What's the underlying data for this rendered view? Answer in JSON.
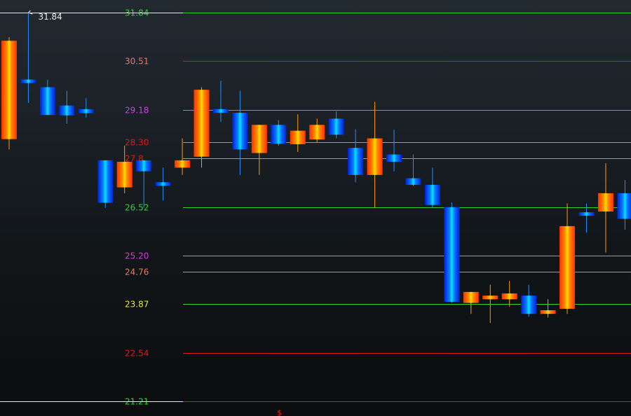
{
  "chart_data": {
    "type": "candlestick",
    "ylim": [
      21.21,
      31.84
    ],
    "high_marker": "31.84",
    "bottom_marker": "$",
    "colors": {
      "up": "#ff8a00",
      "down": "#0a86ff",
      "green": "#2fd22f",
      "red": "#e01818",
      "gray": "#9a9a9a",
      "magenta": "#d23fd2",
      "salmon": "#e07a6a",
      "yellow": "#e6e23a",
      "white": "#e8e8e8"
    },
    "levels": [
      {
        "label": "31.84",
        "value": 31.84,
        "kind": "green",
        "text": "green"
      },
      {
        "label": "30.51",
        "value": 30.51,
        "kind": "red",
        "text": "salmon"
      },
      {
        "label": "29.18",
        "value": 29.18,
        "kind": "green",
        "text": "magenta"
      },
      {
        "label": "28.30",
        "value": 28.3,
        "kind": "gray",
        "text": "red"
      },
      {
        "label": "27.8",
        "value": 27.86,
        "kind": "gray",
        "text": "red"
      },
      {
        "label": "26.52",
        "value": 26.52,
        "kind": "green",
        "text": "green"
      },
      {
        "label": "25.20",
        "value": 25.2,
        "kind": "gray",
        "text": "magenta"
      },
      {
        "label": "24.76",
        "value": 24.76,
        "kind": "gray",
        "text": "salmon"
      },
      {
        "label": "23.87",
        "value": 23.87,
        "kind": "green",
        "text": "yellow"
      },
      {
        "label": "22.54",
        "value": 22.54,
        "kind": "red",
        "text": "red"
      },
      {
        "label": "21.21",
        "value": 21.21,
        "kind": "red",
        "text": "green"
      }
    ],
    "candles": [
      {
        "open": 28.38,
        "high": 31.17,
        "low": 28.1,
        "close": 31.07,
        "dir": "up"
      },
      {
        "open": 30.01,
        "high": 31.84,
        "low": 29.37,
        "close": 29.97,
        "dir": "down"
      },
      {
        "open": 29.8,
        "high": 30.0,
        "low": 29.44,
        "close": 29.04,
        "dir": "down"
      },
      {
        "open": 29.3,
        "high": 29.7,
        "low": 28.8,
        "close": 29.03,
        "dir": "down"
      },
      {
        "open": 29.2,
        "high": 29.5,
        "low": 28.97,
        "close": 29.09,
        "dir": "down"
      },
      {
        "open": 27.8,
        "high": 27.8,
        "low": 26.5,
        "close": 26.64,
        "dir": "down"
      },
      {
        "open": 27.06,
        "high": 28.2,
        "low": 26.9,
        "close": 27.76,
        "dir": "up"
      },
      {
        "open": 27.8,
        "high": 27.8,
        "low": 26.5,
        "close": 27.5,
        "dir": "down"
      },
      {
        "open": 27.2,
        "high": 27.6,
        "low": 26.7,
        "close": 27.13,
        "dir": "down"
      },
      {
        "open": 27.6,
        "high": 28.4,
        "low": 27.4,
        "close": 27.8,
        "dir": "up"
      },
      {
        "open": 27.9,
        "high": 29.8,
        "low": 27.6,
        "close": 29.73,
        "dir": "up"
      },
      {
        "open": 29.2,
        "high": 29.98,
        "low": 28.85,
        "close": 29.1,
        "dir": "down"
      },
      {
        "open": 29.1,
        "high": 29.7,
        "low": 27.4,
        "close": 28.1,
        "dir": "down"
      },
      {
        "open": 28.0,
        "high": 28.7,
        "low": 27.4,
        "close": 28.77,
        "dir": "up"
      },
      {
        "open": 28.77,
        "high": 28.9,
        "low": 28.2,
        "close": 28.25,
        "dir": "down"
      },
      {
        "open": 28.24,
        "high": 29.06,
        "low": 28.03,
        "close": 28.61,
        "dir": "up"
      },
      {
        "open": 28.37,
        "high": 28.94,
        "low": 28.3,
        "close": 28.77,
        "dir": "up"
      },
      {
        "open": 28.94,
        "high": 29.14,
        "low": 28.4,
        "close": 28.5,
        "dir": "down"
      },
      {
        "open": 28.14,
        "high": 28.65,
        "low": 27.2,
        "close": 27.4,
        "dir": "down"
      },
      {
        "open": 27.4,
        "high": 29.4,
        "low": 26.5,
        "close": 28.4,
        "dir": "up"
      },
      {
        "open": 27.96,
        "high": 28.64,
        "low": 27.5,
        "close": 27.76,
        "dir": "down"
      },
      {
        "open": 27.31,
        "high": 27.96,
        "low": 27.1,
        "close": 27.13,
        "dir": "down"
      },
      {
        "open": 27.13,
        "high": 27.6,
        "low": 26.5,
        "close": 26.58,
        "dir": "down"
      },
      {
        "open": 26.52,
        "high": 26.65,
        "low": 23.9,
        "close": 23.93,
        "dir": "down"
      },
      {
        "open": 23.9,
        "high": 24.1,
        "low": 23.6,
        "close": 24.2,
        "dir": "up"
      },
      {
        "open": 24.0,
        "high": 24.4,
        "low": 23.35,
        "close": 24.1,
        "dir": "up"
      },
      {
        "open": 24.0,
        "high": 24.5,
        "low": 23.8,
        "close": 24.16,
        "dir": "up"
      },
      {
        "open": 24.1,
        "high": 24.4,
        "low": 23.52,
        "close": 23.6,
        "dir": "down"
      },
      {
        "open": 23.6,
        "high": 24.0,
        "low": 23.5,
        "close": 23.7,
        "dir": "up"
      },
      {
        "open": 23.74,
        "high": 26.62,
        "low": 23.6,
        "close": 26.0,
        "dir": "up"
      },
      {
        "open": 26.38,
        "high": 26.62,
        "low": 25.82,
        "close": 26.3,
        "dir": "down"
      },
      {
        "open": 26.4,
        "high": 27.72,
        "low": 25.28,
        "close": 26.9,
        "dir": "up"
      },
      {
        "open": 26.9,
        "high": 27.26,
        "low": 25.9,
        "close": 26.2,
        "dir": "down"
      }
    ]
  }
}
